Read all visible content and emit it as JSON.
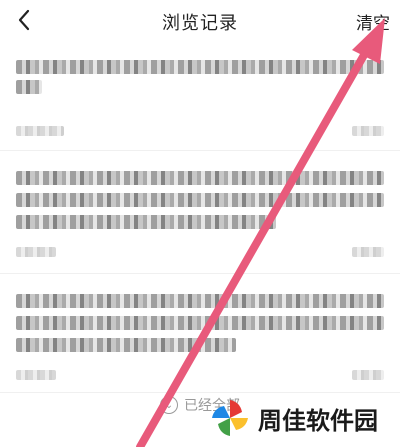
{
  "nav": {
    "back_icon": "chevron-left-icon",
    "title": "浏览记录",
    "clear_label": "清空"
  },
  "footer": {
    "icon": "chevron-down-circle-icon",
    "text": "已经全部"
  },
  "watermark": {
    "text": "周佳软件园"
  },
  "colors": {
    "arrow": "#e85a7b",
    "background": "#ffffff",
    "footer_text": "#999999"
  }
}
